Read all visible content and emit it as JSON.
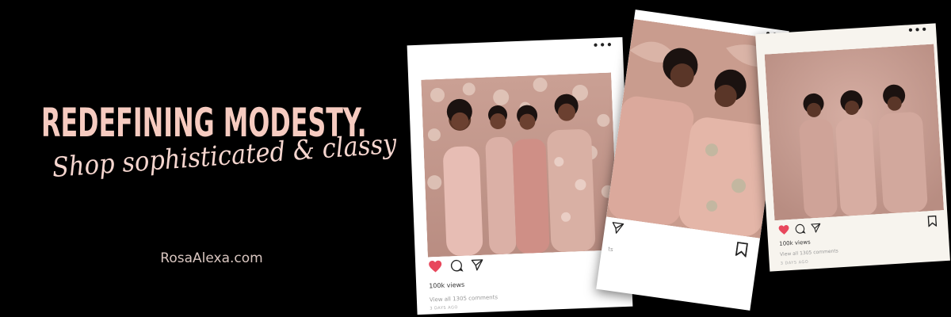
{
  "banner": {
    "headline": "REDEFINING MODESTY.",
    "tagline": "Shop sophisticated & classy",
    "website": "RosaAlexa.com"
  },
  "posts": [
    {
      "menu": "•••",
      "views": "100k views",
      "comments": "View all 1305 comments",
      "ago": "3 DAYS AGO",
      "liked": true
    },
    {
      "menu": "•••",
      "views": "",
      "comments": "ts",
      "ago": "",
      "liked": false
    },
    {
      "menu": "•••",
      "views": "100k views",
      "comments": "View all 1305 comments",
      "ago": "3 DAYS AGO",
      "liked": true
    }
  ],
  "colors": {
    "background": "#000000",
    "headline": "#f6cbc0",
    "tagline": "#f6d6cf",
    "like": "#e8475c"
  },
  "icons": [
    "heart-icon",
    "comment-icon",
    "share-icon",
    "bookmark-icon",
    "more-icon"
  ]
}
